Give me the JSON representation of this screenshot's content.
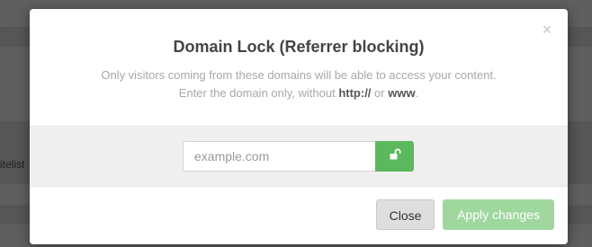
{
  "background": {
    "partial_text": "itelist"
  },
  "modal": {
    "title": "Domain Lock (Referrer blocking)",
    "close_icon": "close-icon",
    "description_line1": "Only visitors coming from these domains will be able to access your content.",
    "description_line2_before": "Enter the domain only, without ",
    "description_line2_http": "http://",
    "description_line2_or": " or ",
    "description_line2_www": "www",
    "description_line2_after": ".",
    "domain_input": {
      "value": "",
      "placeholder": "example.com"
    },
    "lock_button_icon": "unlock-icon",
    "buttons": {
      "close_label": "Close",
      "apply_label": "Apply changes"
    }
  },
  "colors": {
    "accent_green": "#5cb85c",
    "apply_disabled_green": "#9fd79f",
    "band_gray": "#efefef"
  }
}
